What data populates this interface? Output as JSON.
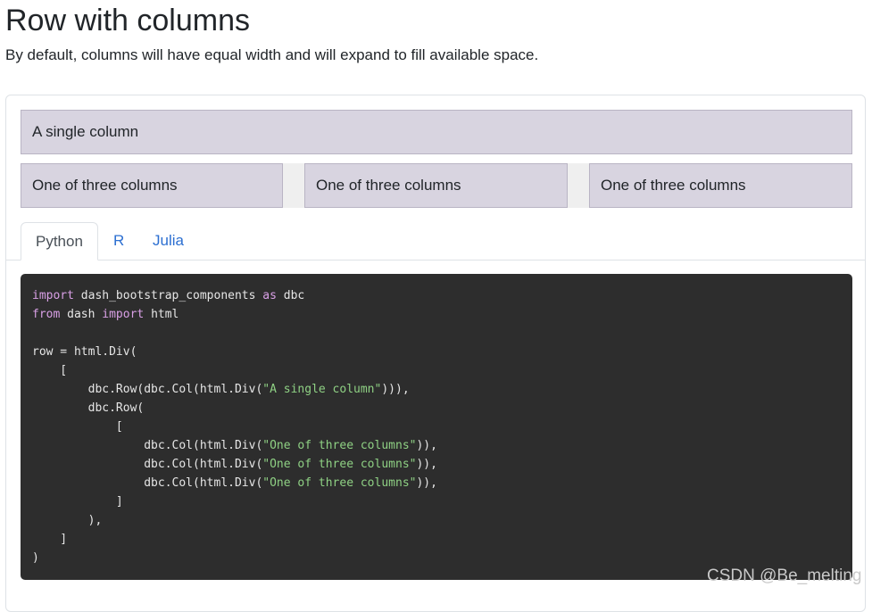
{
  "page": {
    "title": "Row with columns",
    "subtitle": "By default, columns will have equal width and will expand to fill available space."
  },
  "demo": {
    "single_column": "A single column",
    "three_columns": [
      "One of three columns",
      "One of three columns",
      "One of three columns"
    ]
  },
  "tabs": [
    {
      "label": "Python",
      "active": true
    },
    {
      "label": "R",
      "active": false
    },
    {
      "label": "Julia",
      "active": false
    }
  ],
  "code": {
    "lines": [
      [
        [
          "kw",
          "import"
        ],
        [
          "t",
          " dash_bootstrap_components "
        ],
        [
          "kw",
          "as"
        ],
        [
          "t",
          " dbc"
        ]
      ],
      [
        [
          "kw",
          "from"
        ],
        [
          "t",
          " dash "
        ],
        [
          "kw",
          "import"
        ],
        [
          "t",
          " html"
        ]
      ],
      [
        [
          "t",
          ""
        ]
      ],
      [
        [
          "t",
          "row = html.Div("
        ]
      ],
      [
        [
          "t",
          "    ["
        ]
      ],
      [
        [
          "t",
          "        dbc.Row(dbc.Col(html.Div("
        ],
        [
          "str",
          "\"A single column\""
        ],
        [
          "t",
          "))),"
        ]
      ],
      [
        [
          "t",
          "        dbc.Row("
        ]
      ],
      [
        [
          "t",
          "            ["
        ]
      ],
      [
        [
          "t",
          "                dbc.Col(html.Div("
        ],
        [
          "str",
          "\"One of three columns\""
        ],
        [
          "t",
          ")),"
        ]
      ],
      [
        [
          "t",
          "                dbc.Col(html.Div("
        ],
        [
          "str",
          "\"One of three columns\""
        ],
        [
          "t",
          ")),"
        ]
      ],
      [
        [
          "t",
          "                dbc.Col(html.Div("
        ],
        [
          "str",
          "\"One of three columns\""
        ],
        [
          "t",
          ")),"
        ]
      ],
      [
        [
          "t",
          "            ]"
        ]
      ],
      [
        [
          "t",
          "        ),"
        ]
      ],
      [
        [
          "t",
          "    ]"
        ]
      ],
      [
        [
          "t",
          ")"
        ]
      ]
    ]
  },
  "watermark": "CSDN @Be_melting",
  "colors": {
    "column_bg": "#d8d4e0",
    "code_bg": "#2d2d2d",
    "keyword": "#d9a0e6",
    "string": "#8fd184",
    "link": "#2c6fd1"
  }
}
